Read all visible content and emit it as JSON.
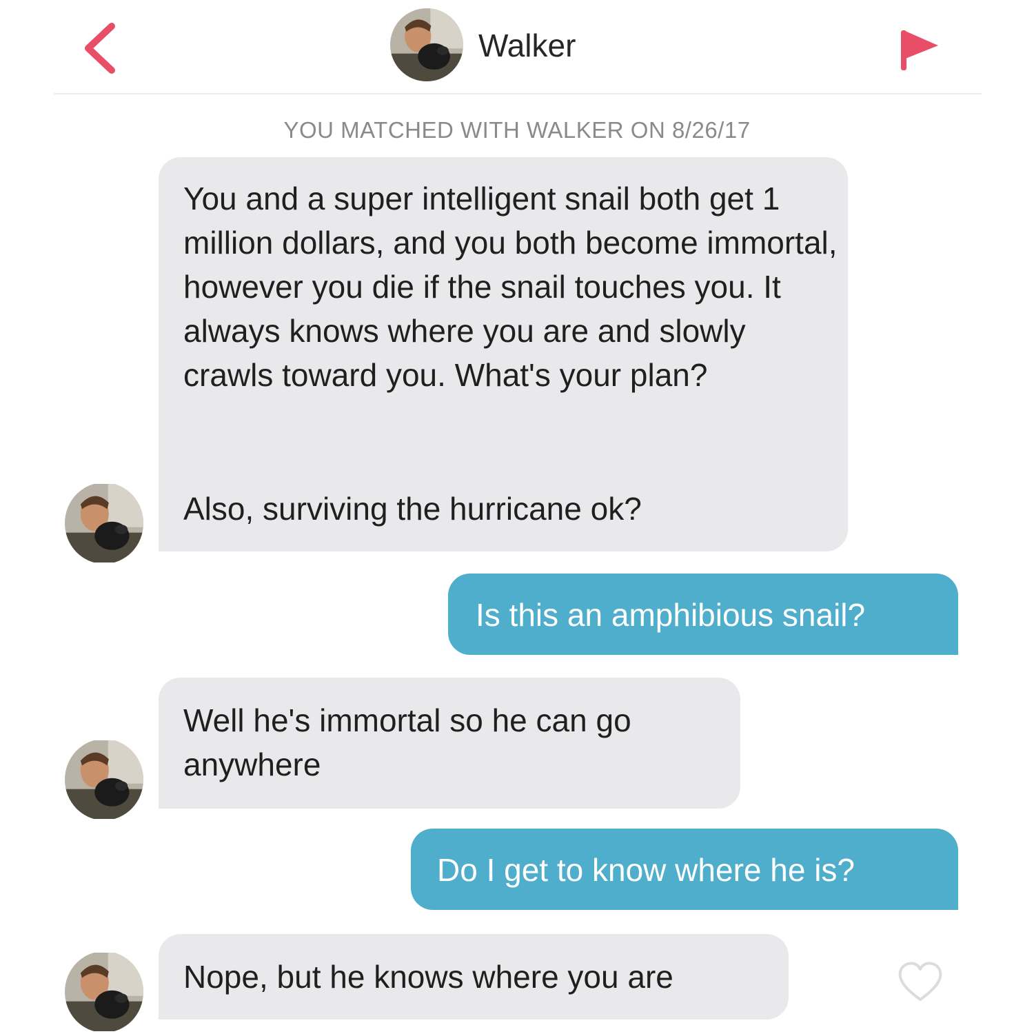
{
  "header": {
    "name": "Walker",
    "back_icon": "chevron-left-icon",
    "flag_icon": "flag-icon",
    "accent_color": "#e94e68"
  },
  "match_info": "YOU MATCHED WITH WALKER ON 8/26/17",
  "messages": [
    {
      "from": "match",
      "text": "You and a super intelligent snail both get 1 million dollars, and you both become immortal, however you die if the snail touches you. It always knows where you are and slowly crawls toward you. What's your plan?",
      "text2": "Also, surviving the hurricane ok?"
    },
    {
      "from": "me",
      "text": "Is this an amphibious snail?"
    },
    {
      "from": "match",
      "text": "Well he's immortal so he can go anywhere"
    },
    {
      "from": "me",
      "text": "Do I get to know where he is?"
    },
    {
      "from": "match",
      "text": "Nope, but he knows where you are"
    }
  ],
  "colors": {
    "incoming_bubble": "#e9e9eb",
    "outgoing_bubble": "#4eaecb"
  },
  "like_icon": "heart-outline-icon"
}
